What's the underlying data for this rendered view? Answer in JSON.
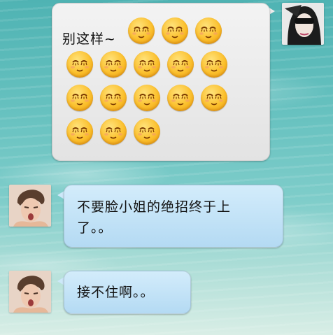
{
  "messages": [
    {
      "from": "me",
      "text": "别这样~",
      "emoji_name": "closed-eyes-smile",
      "emoji_count": 16
    },
    {
      "from": "friend",
      "line1": "不要脸小姐的绝招终于上",
      "line2": "了。。"
    },
    {
      "from": "friend",
      "text": "接不住啊。。"
    }
  ],
  "colors": {
    "outgoing_bubble": "#ececec",
    "incoming_bubble": "#c4e3f7",
    "emoji": "#fbc02d"
  }
}
